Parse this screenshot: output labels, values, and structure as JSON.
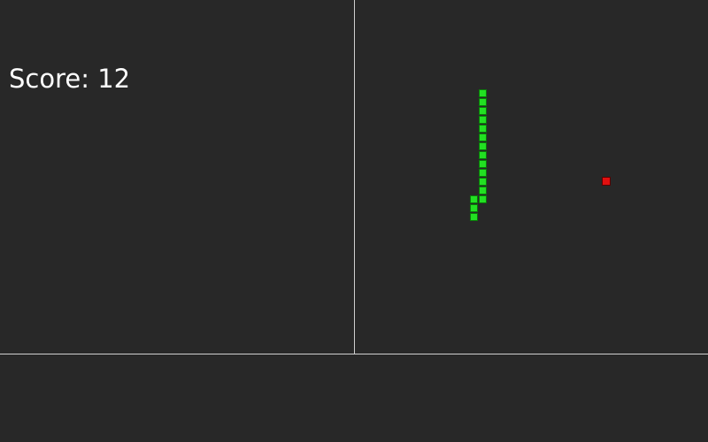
{
  "hud": {
    "score_text": "Score: 12"
  },
  "game": {
    "snake": [
      [
        14,
        10
      ],
      [
        14,
        11
      ],
      [
        14,
        12
      ],
      [
        14,
        13
      ],
      [
        14,
        14
      ],
      [
        14,
        15
      ],
      [
        14,
        16
      ],
      [
        14,
        17
      ],
      [
        14,
        18
      ],
      [
        14,
        19
      ],
      [
        14,
        20
      ],
      [
        14,
        21
      ],
      [
        14,
        22
      ],
      [
        13,
        22
      ],
      [
        13,
        23
      ],
      [
        13,
        24
      ]
    ],
    "food": [
      28,
      20
    ]
  },
  "colors": {
    "background": "#282828",
    "divider": "#d0d0d0",
    "snake": "#22e022",
    "food": "#e01010",
    "text": "#ffffff"
  }
}
